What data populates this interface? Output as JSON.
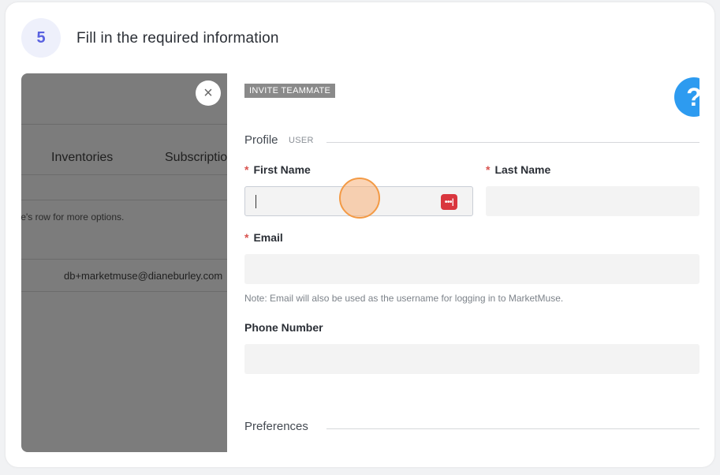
{
  "step": {
    "number": "5",
    "title": "Fill in the required information"
  },
  "background": {
    "nav": [
      "Inventories",
      "Subscriptio"
    ],
    "hint": "te's row for more options.",
    "row_email": "db+marketmuse@dianeburley.com"
  },
  "dialog": {
    "tag": "INVITE TEAMMATE",
    "help_glyph": "?",
    "close_glyph": "×",
    "profile_section": {
      "label": "Profile",
      "sub": "USER"
    },
    "first_name": {
      "label": "First Name",
      "value": "",
      "required": "*"
    },
    "last_name": {
      "label": "Last Name",
      "value": "",
      "required": "*"
    },
    "email": {
      "label": "Email",
      "value": "",
      "required": "*"
    },
    "email_note": "Note: Email will also be used as the username for logging in to MarketMuse.",
    "phone": {
      "label": "Phone Number",
      "value": ""
    },
    "preferences_section": {
      "label": "Preferences"
    },
    "password_icon_glyph": "•••|"
  },
  "colors": {
    "accent": "#5961e0",
    "required": "#d9534f",
    "help": "#2d9bf0",
    "password_manager": "#d9363e",
    "click_marker": "#f39a45"
  }
}
